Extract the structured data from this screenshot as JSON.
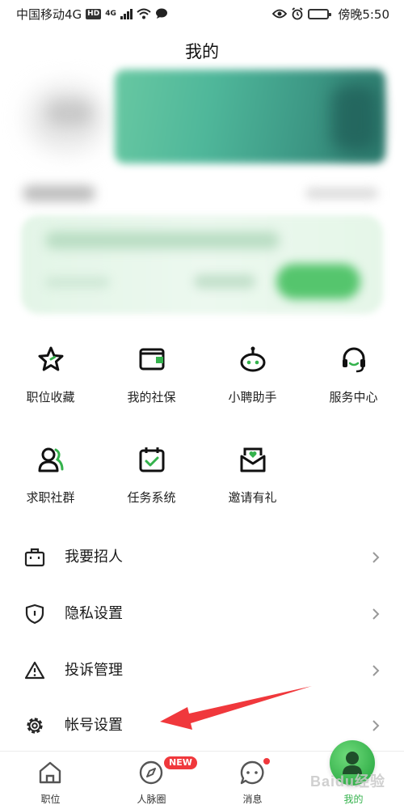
{
  "status_bar": {
    "carrier": "中国移动4G",
    "hd": "HD",
    "net": "4G",
    "time_label": "傍晚5:50"
  },
  "header": {
    "title": "我的"
  },
  "quick_grid": [
    {
      "label": "职位收藏",
      "icon": "star-icon"
    },
    {
      "label": "我的社保",
      "icon": "wallet-icon"
    },
    {
      "label": "小聘助手",
      "icon": "robot-icon"
    },
    {
      "label": "服务中心",
      "icon": "headset-icon"
    },
    {
      "label": "求职社群",
      "icon": "people-icon"
    },
    {
      "label": "任务系统",
      "icon": "calendar-check-icon"
    },
    {
      "label": "邀请有礼",
      "icon": "gift-envelope-icon"
    }
  ],
  "menu": [
    {
      "label": "我要招人",
      "icon": "briefcase-icon"
    },
    {
      "label": "隐私设置",
      "icon": "shield-icon"
    },
    {
      "label": "投诉管理",
      "icon": "warning-icon"
    },
    {
      "label": "帐号设置",
      "icon": "gear-icon"
    }
  ],
  "tabbar": {
    "tabs": [
      {
        "label": "职位",
        "icon": "home-icon"
      },
      {
        "label": "人脉圈",
        "icon": "compass-icon",
        "badge": "NEW"
      },
      {
        "label": "消息",
        "icon": "chat-icon"
      },
      {
        "label": "我的",
        "icon": "profile-icon"
      }
    ],
    "active_index": 3
  },
  "watermark": "Baidu经验",
  "colors": {
    "accent_green": "#34b24c",
    "badge_red": "#f0383c",
    "arrow_red": "#f0383c"
  }
}
